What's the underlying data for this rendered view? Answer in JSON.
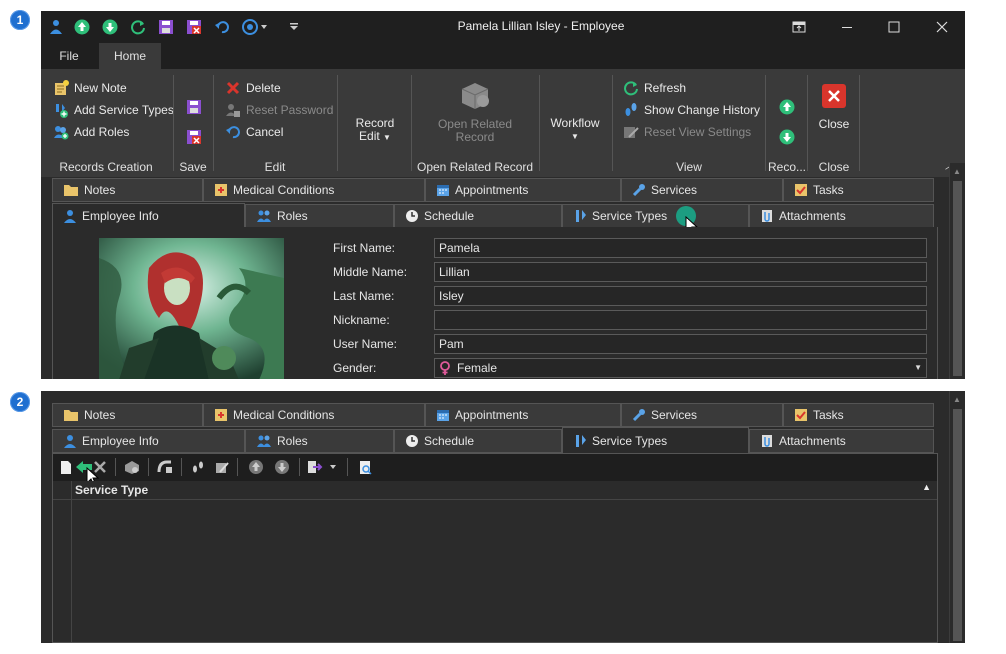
{
  "steps": [
    "1",
    "2"
  ],
  "window": {
    "title": "Pamela Lillian Isley - Employee",
    "ribbon_tabs": [
      "File",
      "Home"
    ]
  },
  "ribbon": {
    "records_creation": {
      "new_note": "New Note",
      "add_service_types": "Add Service Types",
      "add_roles": "Add Roles",
      "label": "Records Creation"
    },
    "save": {
      "label": "Save"
    },
    "edit": {
      "delete": "Delete",
      "reset_password": "Reset Password",
      "cancel": "Cancel",
      "label": "Edit"
    },
    "record_edit": {
      "line1": "Record",
      "line2": "Edit"
    },
    "open_related": {
      "line1": "Open Related",
      "line2": "Record",
      "label": "Open Related Record"
    },
    "workflow": {
      "label": "Workflow"
    },
    "view": {
      "refresh": "Refresh",
      "show_change_history": "Show Change History",
      "reset_view_settings": "Reset View Settings",
      "label": "View"
    },
    "record_nav": {
      "label": "Reco..."
    },
    "close": {
      "button": "Close",
      "label": "Close"
    }
  },
  "tabs_row1": [
    "Notes",
    "Medical Conditions",
    "Appointments",
    "Services",
    "Tasks"
  ],
  "tabs_row2": [
    "Employee Info",
    "Roles",
    "Schedule",
    "Service Types",
    "Attachments"
  ],
  "form": {
    "first_name_label": "First Name:",
    "first_name": "Pamela",
    "middle_name_label": "Middle Name:",
    "middle_name": "Lillian",
    "last_name_label": "Last Name:",
    "last_name": "Isley",
    "nickname_label": "Nickname:",
    "nickname": "",
    "user_name_label": "User Name:",
    "user_name": "Pam",
    "gender_label": "Gender:",
    "gender": "Female"
  },
  "service_types_grid": {
    "column": "Service Type"
  },
  "colors": {
    "accent_green": "#2fbf7a",
    "close_red": "#d9352c",
    "badge_blue": "#1f6fd0",
    "cursor_highlight": "#19a88a"
  }
}
